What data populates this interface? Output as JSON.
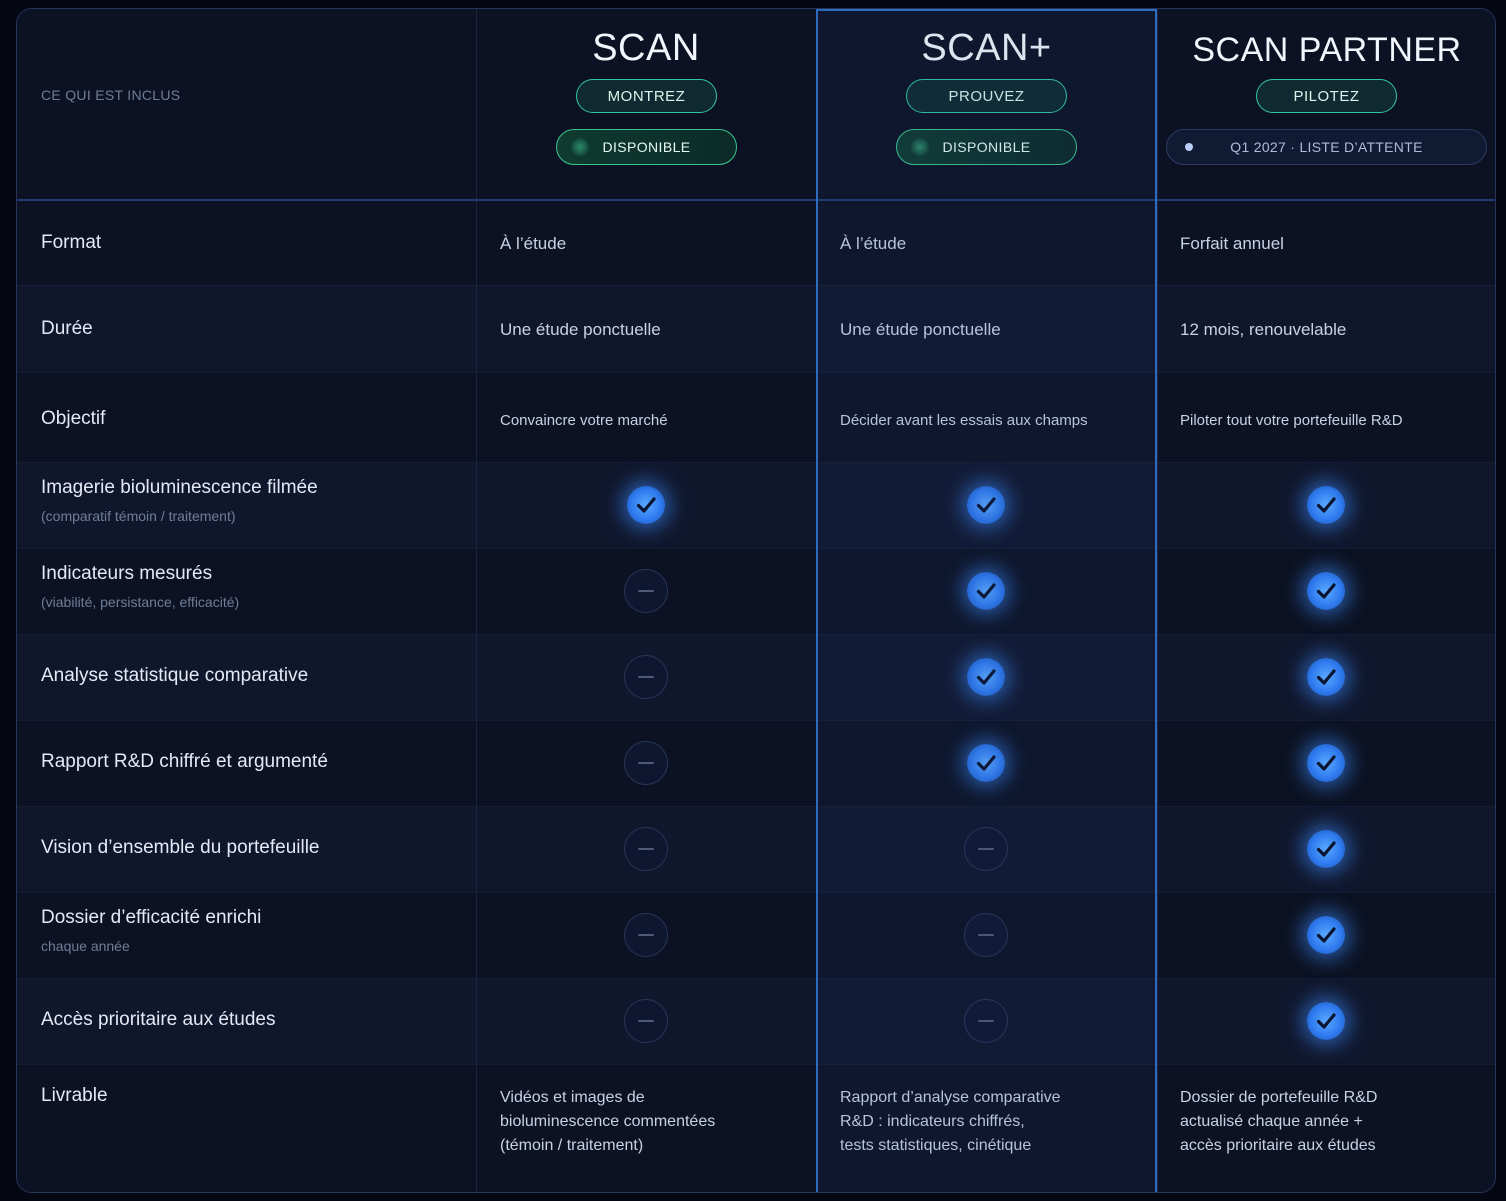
{
  "header": {
    "included_label": "CE QUI EST INCLUS"
  },
  "plans": [
    {
      "name": "SCAN",
      "tag": "MONTREZ",
      "status": "DISPONIBLE",
      "status_type": "available"
    },
    {
      "name": "SCAN+",
      "tag": "PROUVEZ",
      "status": "DISPONIBLE",
      "status_type": "available"
    },
    {
      "name": "SCAN PARTNER",
      "tag": "PILOTEZ",
      "status": "Q1 2027 · LISTE D’ATTENTE",
      "status_type": "waitlist"
    }
  ],
  "rows": {
    "format": {
      "label": "Format",
      "values": [
        "À l’étude",
        "À l’étude",
        "Forfait annuel"
      ]
    },
    "duree": {
      "label": "Durée",
      "values": [
        "Une étude ponctuelle",
        "Une étude ponctuelle",
        "12 mois, renouvelable"
      ]
    },
    "objectif": {
      "label": "Objectif",
      "values": [
        "Convaincre votre marché",
        "Décider avant les essais aux champs",
        "Piloter tout votre portefeuille R&D"
      ]
    },
    "imagerie": {
      "label": "Imagerie bioluminescence filmée",
      "sub": "(comparatif témoin / traitement)",
      "included": [
        true,
        true,
        true
      ]
    },
    "indicateurs": {
      "label": "Indicateurs mesurés",
      "sub": "(viabilité, persistance, efficacité)",
      "included": [
        false,
        true,
        true
      ]
    },
    "analyse": {
      "label": "Analyse statistique comparative",
      "included": [
        false,
        true,
        true
      ]
    },
    "rapport": {
      "label": "Rapport R&D chiffré et argumenté",
      "included": [
        false,
        true,
        true
      ]
    },
    "vision": {
      "label": "Vision d’ensemble du portefeuille",
      "included": [
        false,
        false,
        true
      ]
    },
    "dossier": {
      "label": "Dossier d’efficacité enrichi",
      "sub": "chaque année",
      "included": [
        false,
        false,
        true
      ]
    },
    "acces": {
      "label": "Accès prioritaire aux études",
      "included": [
        false,
        false,
        true
      ]
    },
    "livrable": {
      "label": "Livrable",
      "values": [
        [
          "Vidéos et images de",
          "bioluminescence commentées",
          "(témoin / traitement)"
        ],
        [
          "Rapport d’analyse comparative",
          "R&D : indicateurs chiffrés,",
          "tests statistiques, cinétique"
        ],
        [
          "Dossier de portefeuille R&D",
          "actualisé chaque année +",
          "accès prioritaire aux études"
        ]
      ]
    }
  },
  "icons": {
    "check": "checkmark-icon",
    "not_included": "minus-icon"
  },
  "colors": {
    "background": "#0d1426",
    "highlight_border": "#2e6bbf",
    "pill_border": "#33c6a0",
    "check_glow": "#3c8cff"
  }
}
